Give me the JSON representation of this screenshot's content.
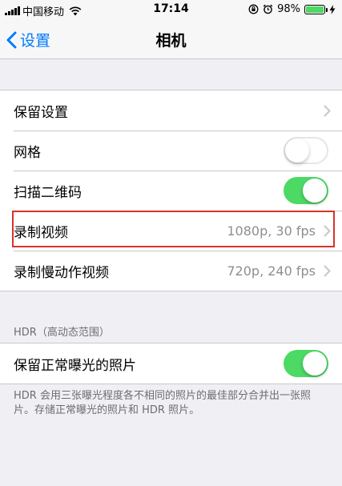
{
  "status_bar": {
    "carrier": "中国移动",
    "time": "17:14",
    "battery_percent": "98%",
    "icons": [
      "signal-icon",
      "wifi-icon",
      "orientation-lock-icon",
      "alarm-icon",
      "battery-icon",
      "charging-icon"
    ]
  },
  "nav": {
    "back_label": "设置",
    "title": "相机"
  },
  "group1": {
    "rows": [
      {
        "label": "保留设置",
        "type": "link"
      },
      {
        "label": "网格",
        "type": "toggle",
        "on": false
      },
      {
        "label": "扫描二维码",
        "type": "toggle",
        "on": true
      },
      {
        "label": "录制视频",
        "type": "link",
        "value": "1080p, 30 fps"
      },
      {
        "label": "录制慢动作视频",
        "type": "link",
        "value": "720p, 240 fps"
      }
    ]
  },
  "hdr_section": {
    "header": "HDR（高动态范围）",
    "rows": [
      {
        "label": "保留正常曝光的照片",
        "type": "toggle",
        "on": true
      }
    ],
    "footer": "HDR 会用三张曝光程度各不相同的照片的最佳部分合并出一张照片。存储正常曝光的照片和 HDR 照片。"
  },
  "colors": {
    "accent": "#007aff",
    "toggle_on": "#4cd964",
    "highlight_box": "#d6342b"
  }
}
